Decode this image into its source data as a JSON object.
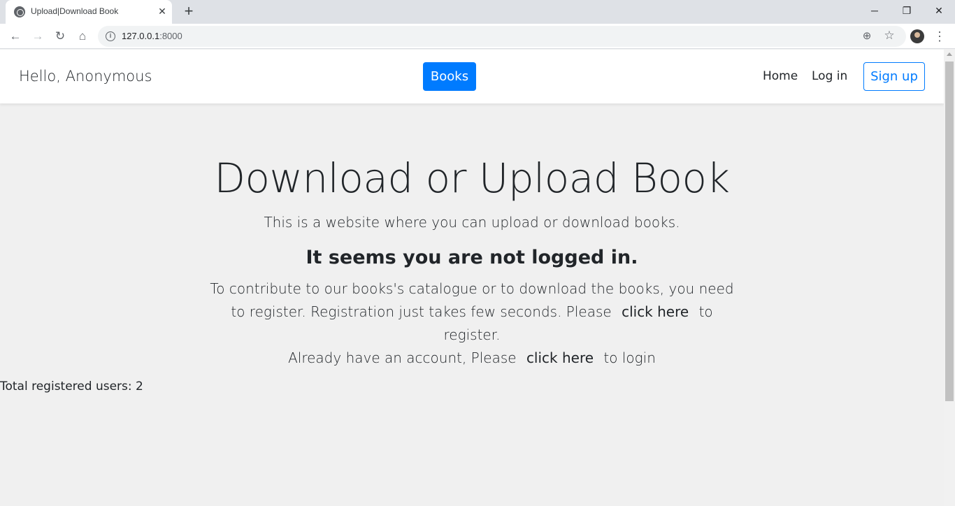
{
  "browser": {
    "tab_title": "Upload|Download Book",
    "url_host": "127.0.0.1",
    "url_port": ":8000"
  },
  "navbar": {
    "brand": "Hello, Anonymous",
    "books_button": "Books",
    "home_link": "Home",
    "login_link": "Log in",
    "signup_button": "Sign up"
  },
  "hero": {
    "title": "Download or Upload Book",
    "subtitle": "This is a website where you can upload or download books.",
    "notice": "It seems you are not logged in.",
    "para_part1": "To contribute to our books's catalogue or to download the books, you need to register. Registration just takes few seconds. Please",
    "register_link": "click here",
    "para_part2": "to register.",
    "para_part3": "Already have an account, Please",
    "login_link": "click here",
    "para_part4": "to login"
  },
  "footer": {
    "total_users": "Total registered users: 2"
  },
  "colors": {
    "primary": "#007bff",
    "page_bg": "#f0f0f0"
  }
}
